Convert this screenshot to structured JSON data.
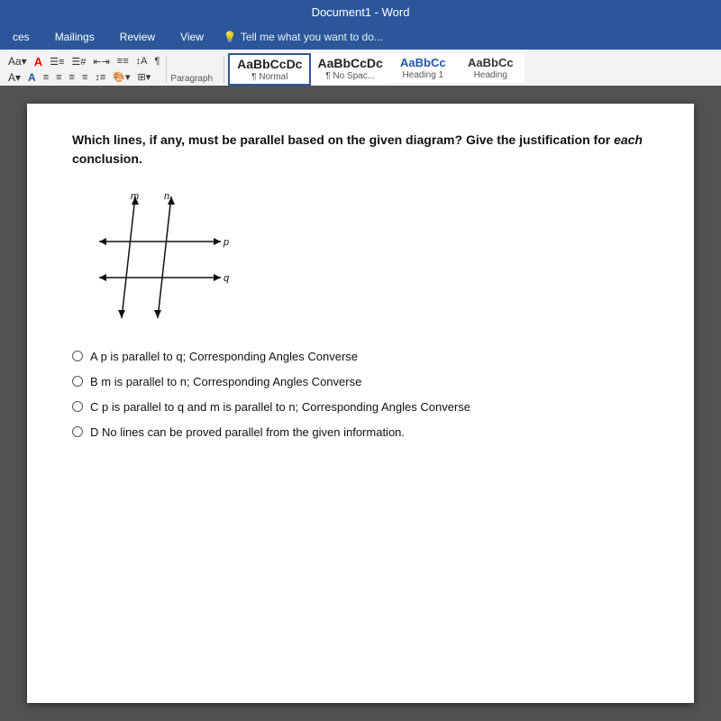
{
  "titleBar": {
    "text": "Document1 - Word"
  },
  "menuBar": {
    "items": [
      "ces",
      "Mailings",
      "Review",
      "View"
    ],
    "tellMe": "Tell me what you want to do..."
  },
  "ribbon": {
    "paragraphLabel": "Paragraph",
    "styles": [
      {
        "id": "normal",
        "preview": "AaBbCcDc",
        "label": "¶ Normal",
        "selected": true
      },
      {
        "id": "no-space",
        "preview": "AaBbCcDc",
        "label": "¶ No Spac..."
      },
      {
        "id": "heading1",
        "preview": "AaBbCc",
        "label": "Heading 1"
      },
      {
        "id": "heading",
        "preview": "AaBbCc",
        "label": "Heading"
      }
    ]
  },
  "document": {
    "questionText": "Which lines, if any, must be parallel based on the given diagram? Give the justification for each conclusion.",
    "answers": [
      {
        "id": "A",
        "label": "A p is parallel to q; Corresponding Angles Converse"
      },
      {
        "id": "B",
        "label": "B m is parallel to n; Corresponding Angles Converse"
      },
      {
        "id": "C",
        "label": "C p is parallel to q and m is parallel to n; Corresponding Angles Converse"
      },
      {
        "id": "D",
        "label": "D No lines can be proved parallel from the given information."
      }
    ]
  }
}
